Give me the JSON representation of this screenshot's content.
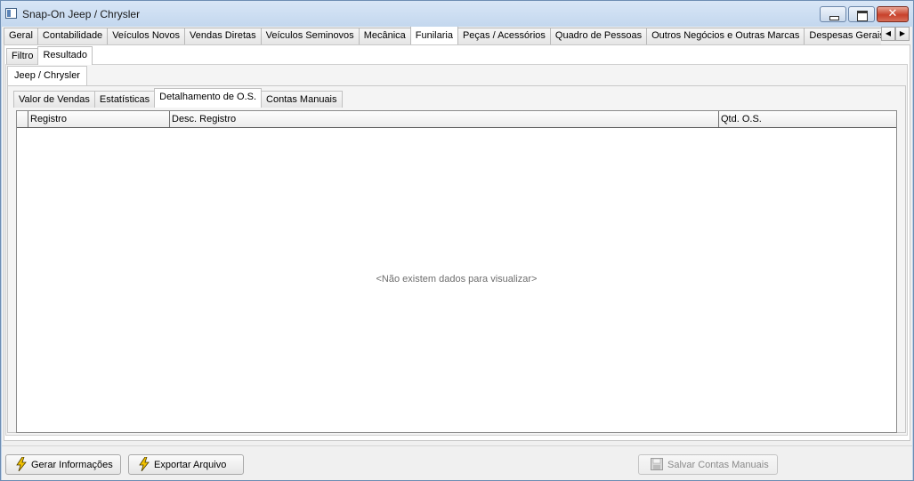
{
  "window": {
    "title": "Snap-On Jeep / Chrysler"
  },
  "top_tabs": [
    {
      "label": "Geral",
      "active": false
    },
    {
      "label": "Contabilidade",
      "active": false
    },
    {
      "label": "Veículos Novos",
      "active": false
    },
    {
      "label": "Vendas Diretas",
      "active": false
    },
    {
      "label": "Veículos Seminovos",
      "active": false
    },
    {
      "label": "Mecânica",
      "active": false
    },
    {
      "label": "Funilaria",
      "active": true
    },
    {
      "label": "Peças / Acessórios",
      "active": false
    },
    {
      "label": "Quadro de Pessoas",
      "active": false
    },
    {
      "label": "Outros Negócios e Outras Marcas",
      "active": false
    },
    {
      "label": "Despesas Gerais por D",
      "active": false
    }
  ],
  "mode_tabs": [
    {
      "label": "Filtro",
      "active": false
    },
    {
      "label": "Resultado",
      "active": true
    }
  ],
  "brand_tab": {
    "label": "Jeep / Chrysler"
  },
  "inner_tabs": [
    {
      "label": "Valor de Vendas",
      "active": false
    },
    {
      "label": "Estatísticas",
      "active": false
    },
    {
      "label": "Detalhamento de O.S.",
      "active": true
    },
    {
      "label": "Contas Manuais",
      "active": false
    }
  ],
  "grid": {
    "columns": [
      "Registro",
      "Desc. Registro",
      "Qtd. O.S."
    ],
    "rows": [],
    "empty_message": "<Não existem dados para visualizar>"
  },
  "buttons": {
    "gerar": {
      "label": "Gerar Informações",
      "icon": "lightning-icon",
      "enabled": true
    },
    "exportar": {
      "label": "Exportar Arquivo",
      "icon": "lightning-icon",
      "enabled": true
    },
    "salvar": {
      "label": "Salvar Contas Manuais",
      "icon": "save-disk-icon",
      "enabled": false
    }
  },
  "colors": {
    "titlebar": "#c3d7ee",
    "close_button": "#c8412b",
    "lightning": "#f2c200"
  }
}
